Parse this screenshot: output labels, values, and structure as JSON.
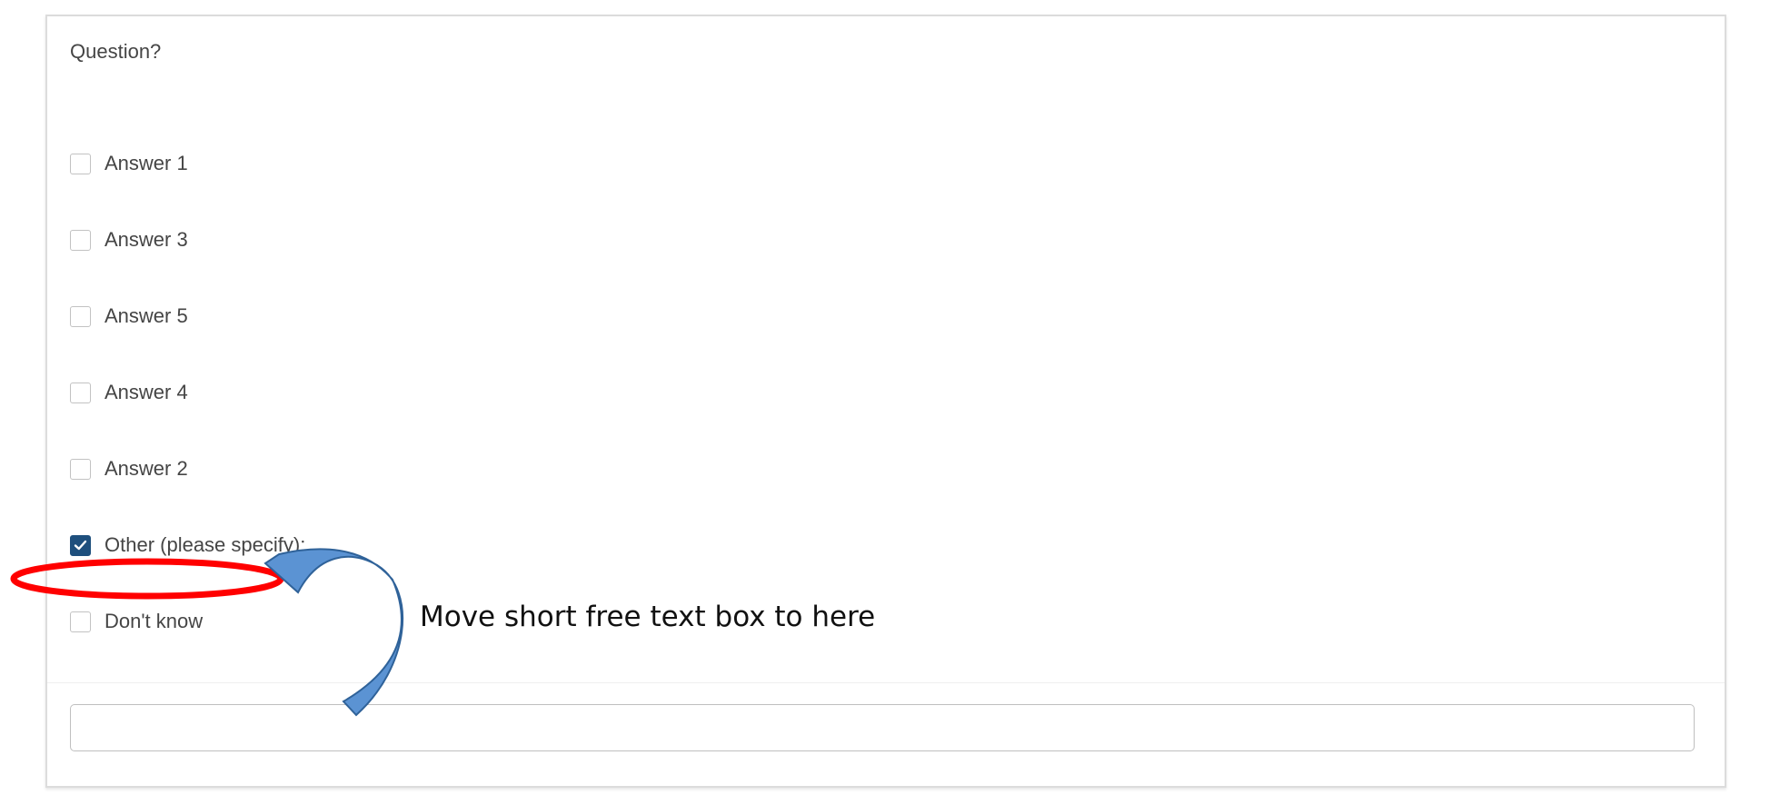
{
  "question": {
    "text": "Question?"
  },
  "options": [
    {
      "label": "Answer 1",
      "checked": false
    },
    {
      "label": "Answer 3",
      "checked": false
    },
    {
      "label": "Answer 5",
      "checked": false
    },
    {
      "label": "Answer 4",
      "checked": false
    },
    {
      "label": "Answer 2",
      "checked": false
    },
    {
      "label": "Other (please specify):",
      "checked": true
    },
    {
      "label": "Don't know",
      "checked": false
    }
  ],
  "free_text": {
    "value": "",
    "placeholder": ""
  },
  "annotation": {
    "text": "Move short free text box to here",
    "ellipse_color": "#ff0000",
    "arrow_color": "#4a7fbf"
  },
  "colors": {
    "checkbox_checked": "#1e4f7d",
    "text": "#454545"
  }
}
